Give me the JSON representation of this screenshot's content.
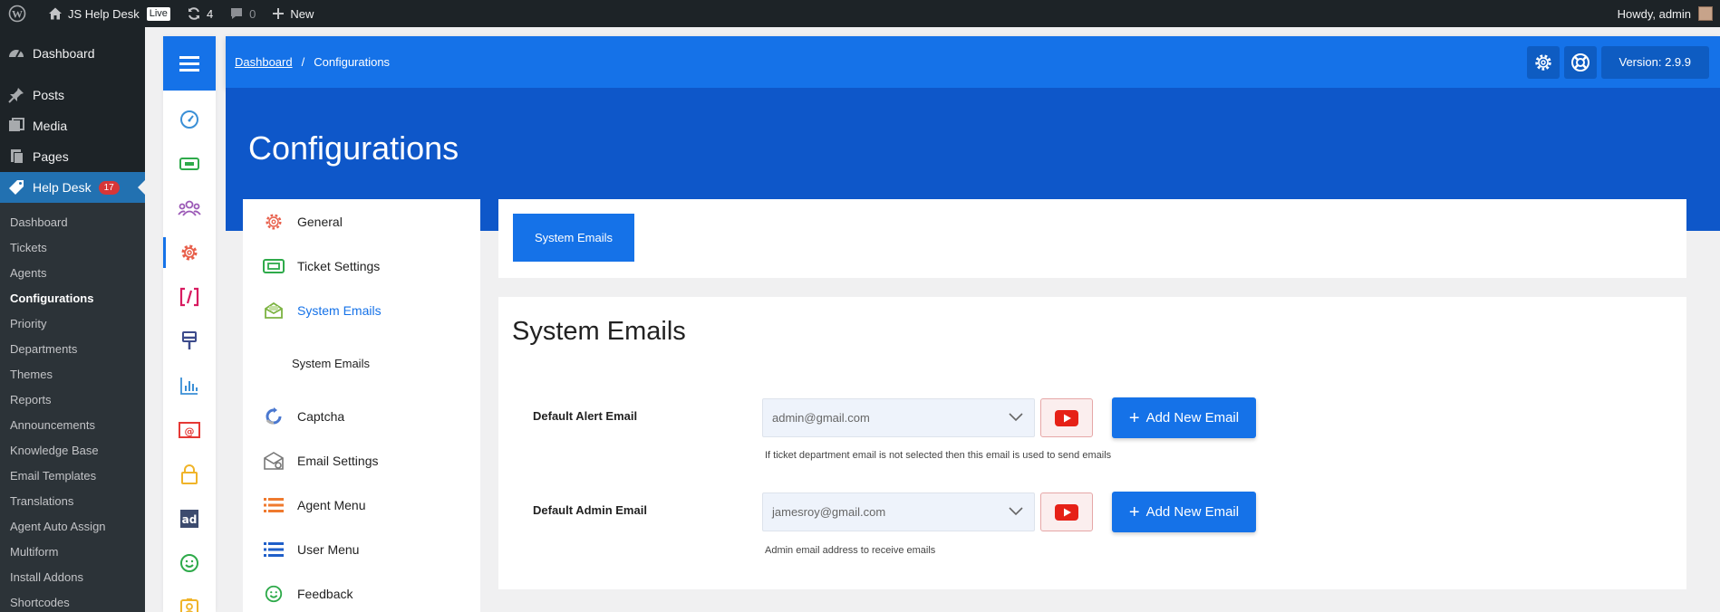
{
  "adminbar": {
    "site_name": "JS Help Desk",
    "live_badge": "Live",
    "updates_count": "4",
    "comments_count": "0",
    "new_label": "New",
    "greeting": "Howdy, admin"
  },
  "wp_menu": {
    "dashboard": "Dashboard",
    "posts": "Posts",
    "media": "Media",
    "pages": "Pages",
    "helpdesk": "Help Desk",
    "helpdesk_count": "17",
    "submenu": [
      "Dashboard",
      "Tickets",
      "Agents",
      "Configurations",
      "Priority",
      "Departments",
      "Themes",
      "Reports",
      "Announcements",
      "Knowledge Base",
      "Email Templates",
      "Translations",
      "Agent Auto Assign",
      "Multiform",
      "Install Addons",
      "Shortcodes"
    ],
    "current_submenu": "Configurations"
  },
  "rail_icons": [
    "dashboard-gauge-icon",
    "ticket-icon",
    "users-icon",
    "gear-icon",
    "shortcode-icon",
    "brush-icon",
    "bar-chart-icon",
    "email-icon",
    "lock-icon",
    "ad-icon",
    "smile-icon",
    "id-card-icon"
  ],
  "topbar": {
    "breadcrumb_home": "Dashboard",
    "breadcrumb_separator": "/",
    "breadcrumb_current": "Configurations",
    "version": "Version: 2.9.9"
  },
  "page_title": "Configurations",
  "config_menu": {
    "items": [
      {
        "label": "General",
        "icon": "gear-icon",
        "color": "#e8604c"
      },
      {
        "label": "Ticket Settings",
        "icon": "ticket-icon",
        "color": "#2eaa4a"
      },
      {
        "label": "System Emails",
        "icon": "envelope-icon",
        "color": "#7cb342",
        "active": true
      },
      {
        "label": "Captcha",
        "icon": "recaptcha-icon",
        "color": "#4a78d0"
      },
      {
        "label": "Email Settings",
        "icon": "email-settings-icon",
        "color": "#777777"
      },
      {
        "label": "Agent Menu",
        "icon": "list-icon",
        "color": "#ef7a2e"
      },
      {
        "label": "User Menu",
        "icon": "list-icon",
        "color": "#1f5fc9"
      },
      {
        "label": "Feedback",
        "icon": "smile-icon",
        "color": "#2eaa4a"
      }
    ],
    "sub_item": "System Emails"
  },
  "tab": {
    "label": "System Emails"
  },
  "section": {
    "title": "System Emails",
    "rows": [
      {
        "label": "Default Alert Email",
        "value": "admin@gmail.com",
        "help": "If ticket department email is not selected then this email is used to send emails",
        "button": "Add New Email"
      },
      {
        "label": "Default Admin Email",
        "value": "jamesroy@gmail.com",
        "help": "Admin email address to receive emails",
        "button": "Add New Email"
      }
    ]
  },
  "colors": {
    "primary": "#1572e8",
    "banner": "#0e57c9",
    "wp_dark": "#1d2327",
    "wp_current": "#2271b1"
  }
}
